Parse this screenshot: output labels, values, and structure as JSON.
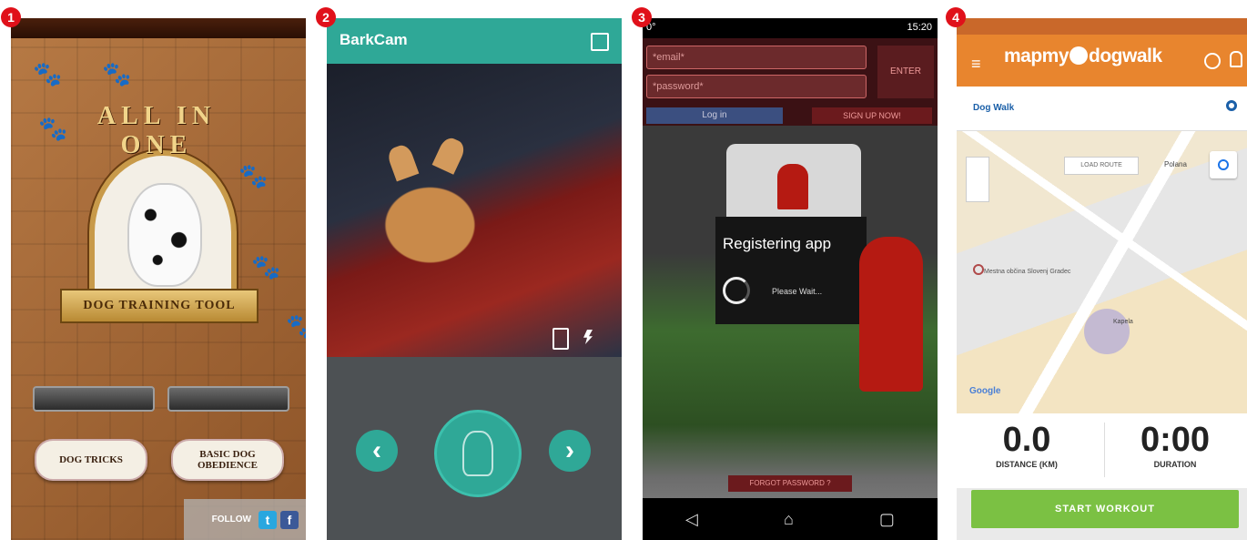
{
  "badges": [
    "1",
    "2",
    "3",
    "4"
  ],
  "p1": {
    "title": "ALL IN ONE",
    "ribbon": "DOG TRAINING TOOL",
    "bone_left": "DOG TRICKS",
    "bone_right": "BASIC DOG OBEDIENCE",
    "follow": "FOLLOW",
    "twitter": "t",
    "facebook": "f"
  },
  "p2": {
    "brand": "BarkCam",
    "prev": "‹",
    "next": "›"
  },
  "p3": {
    "status_left": "0°",
    "status_time": "15:20",
    "email_placeholder": "*email*",
    "password_placeholder": "*password*",
    "enter": "ENTER",
    "login": "Log in",
    "signup": "SIGN UP NOW!",
    "dialog_title": "Registering app",
    "dialog_msg": "Please Wait...",
    "forgot": "FORGOT PASSWORD ?"
  },
  "p4": {
    "logo": "mapmy",
    "logo2": "dogwalk",
    "activity": "Dog Walk",
    "route_btn": "LOAD ROUTE",
    "place1": "Polanа",
    "place2": "Mestna občina Slovenj Gradec",
    "place3": "Kapela",
    "google": "Google",
    "distance_value": "0.0",
    "distance_label": "DISTANCE (KM)",
    "duration_value": "0:00",
    "duration_label": "DURATION",
    "start": "START WORKOUT"
  },
  "colors": {
    "teal": "#2fa897",
    "orange": "#e8852e",
    "green": "#7bc143",
    "red": "#e0111a"
  }
}
